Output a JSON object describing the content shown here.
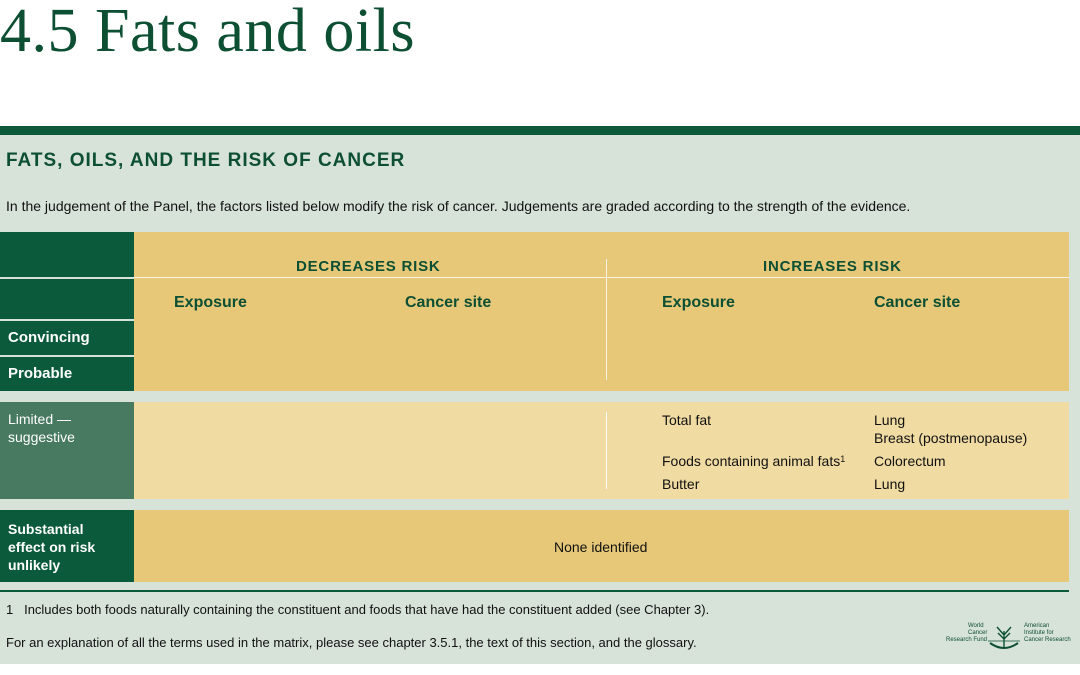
{
  "page": {
    "title": "4.5 Fats and oils"
  },
  "panel": {
    "heading": "FATS, OILS, AND THE RISK OF CANCER",
    "intro": "In the judgement of the Panel, the factors listed below modify the risk of cancer. Judgements are graded according to the strength of the evidence."
  },
  "matrix": {
    "decreases_label": "DECREASES RISK",
    "increases_label": "INCREASES RISK",
    "exposure_label": "Exposure",
    "cancer_site_label": "Cancer site",
    "rows": {
      "convincing": "Convincing",
      "probable": "Probable",
      "limited_line1": "Limited —",
      "limited_line2": "suggestive",
      "substantial_line1": "Substantial",
      "substantial_line2": "effect on risk",
      "substantial_line3": "unlikely"
    },
    "limited_increases": [
      {
        "exposure": "Total fat",
        "sites": [
          "Lung",
          "Breast (postmenopause)"
        ]
      },
      {
        "exposure": "Foods containing animal fats",
        "footnote_mark": "1",
        "sites": [
          "Colorectum"
        ]
      },
      {
        "exposure": "Butter",
        "sites": [
          "Lung"
        ]
      }
    ],
    "substantial_text": "None identified"
  },
  "footer": {
    "footnote_number": "1",
    "footnote_text": "Includes both foods naturally containing the constituent and foods that have had the constituent added (see Chapter 3).",
    "explanation": "For an explanation of all the terms used in the matrix, please see chapter 3.5.1, the text of this section, and the glossary."
  },
  "logo": {
    "left_lines": [
      "World",
      "Cancer",
      "Research Fund"
    ],
    "right_lines": [
      "American",
      "Institute for",
      "Cancer Research"
    ]
  },
  "colors": {
    "dark_green": "#0c5a3c",
    "mid_green": "#477a60",
    "panel_bg": "#d7e2d9",
    "gold": "#e6c878",
    "light_gold": "#f0dba3"
  }
}
